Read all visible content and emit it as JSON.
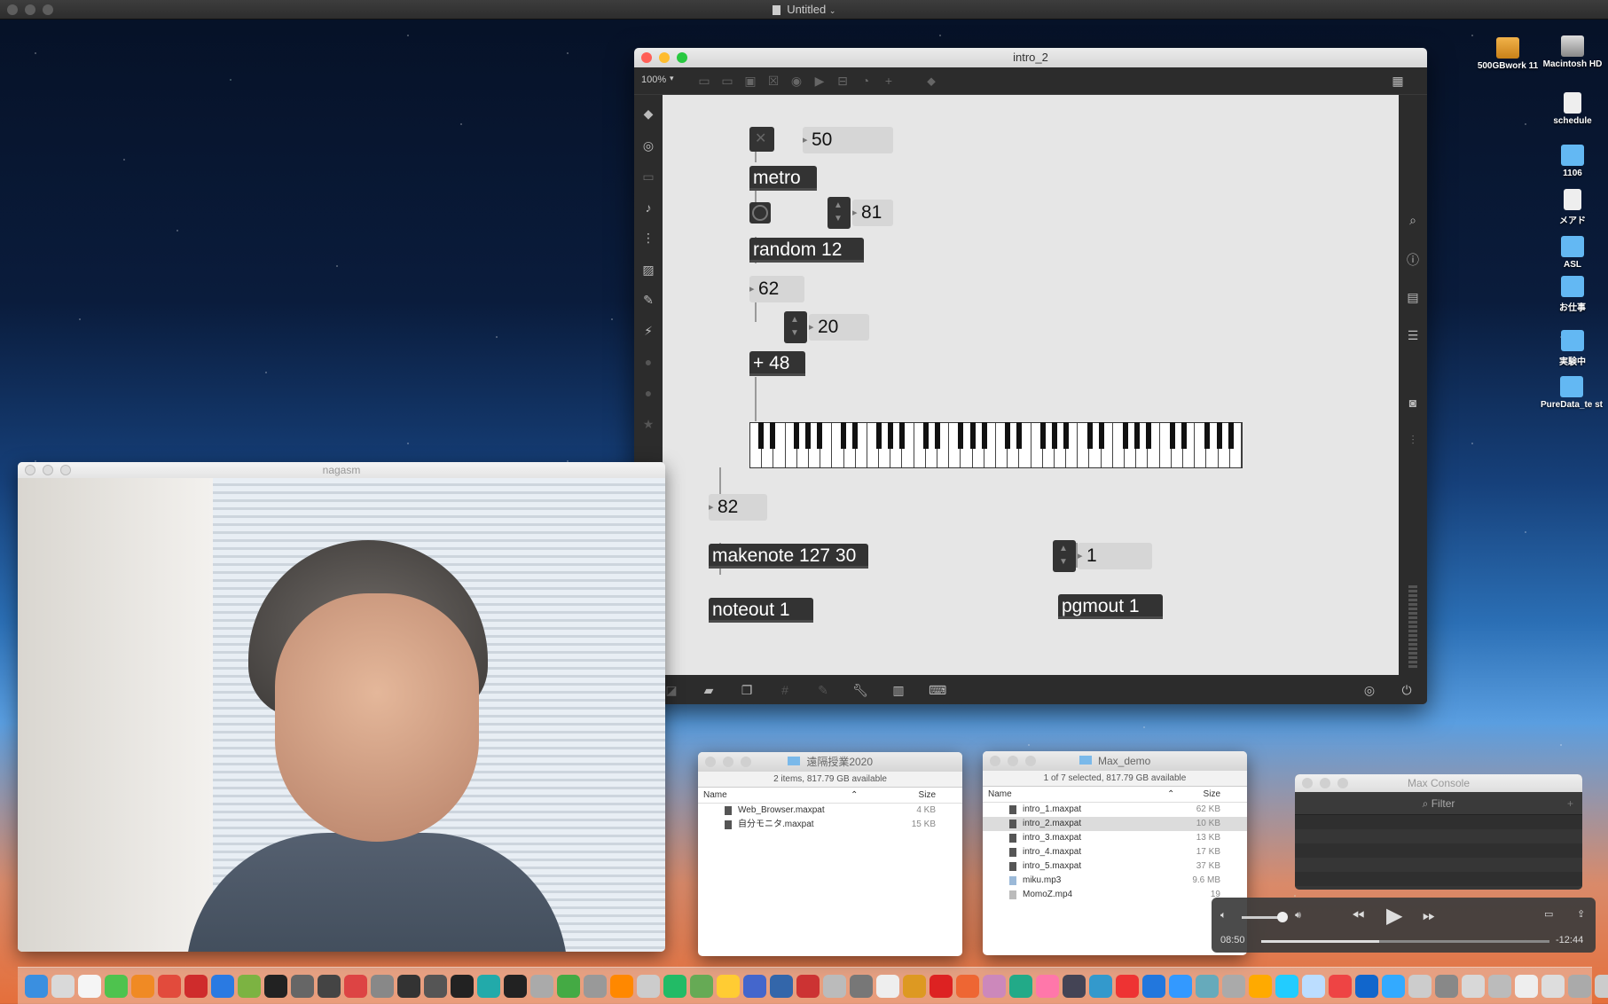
{
  "menubar": {
    "title": "Untitled"
  },
  "desktop_icons": [
    {
      "label": "500GBwork 11",
      "kind": "drive"
    },
    {
      "label": "Macintosh HD",
      "kind": "hd"
    },
    {
      "label": "schedule",
      "kind": "doc"
    },
    {
      "label": "1106",
      "kind": "folder"
    },
    {
      "label": "メアド",
      "kind": "doc"
    },
    {
      "label": "ASL",
      "kind": "folder"
    },
    {
      "label": "お仕事",
      "kind": "folder"
    },
    {
      "label": "実験中",
      "kind": "folder"
    },
    {
      "label": "PureData_te st",
      "kind": "folder"
    }
  ],
  "patcher": {
    "title": "intro_2",
    "zoom": "100%",
    "objects": {
      "metro": "metro",
      "random": "random 12",
      "plus": "+ 48",
      "makenote": "makenote 127 30",
      "noteout": "noteout 1",
      "pgmout": "pgmout 1"
    },
    "numbers": {
      "metro_rate": "50",
      "random_range": "81",
      "random_out": "62",
      "offset": "20",
      "note": "82",
      "program": "1"
    }
  },
  "webcam": {
    "title": "nagasm"
  },
  "finder1": {
    "title": "遠隔授業2020",
    "status": "2 items, 817.79 GB available",
    "col_name": "Name",
    "col_size": "Size",
    "files": [
      {
        "name": "Web_Browser.maxpat",
        "size": "4 KB"
      },
      {
        "name": "自分モニタ.maxpat",
        "size": "15 KB"
      }
    ]
  },
  "finder2": {
    "title": "Max_demo",
    "status": "1 of 7 selected, 817.79 GB available",
    "col_name": "Name",
    "col_size": "Size",
    "files": [
      {
        "name": "intro_1.maxpat",
        "size": "62 KB"
      },
      {
        "name": "intro_2.maxpat",
        "size": "10 KB"
      },
      {
        "name": "intro_3.maxpat",
        "size": "13 KB"
      },
      {
        "name": "intro_4.maxpat",
        "size": "17 KB"
      },
      {
        "name": "intro_5.maxpat",
        "size": "37 KB"
      },
      {
        "name": "miku.mp3",
        "size": "9.6 MB"
      },
      {
        "name": "MomoZ.mp4",
        "size": "19"
      }
    ]
  },
  "console": {
    "title": "Max Console",
    "filter_placeholder": "Filter"
  },
  "player": {
    "elapsed": "08:50",
    "remaining": "-12:44",
    "progress": 0.41
  }
}
